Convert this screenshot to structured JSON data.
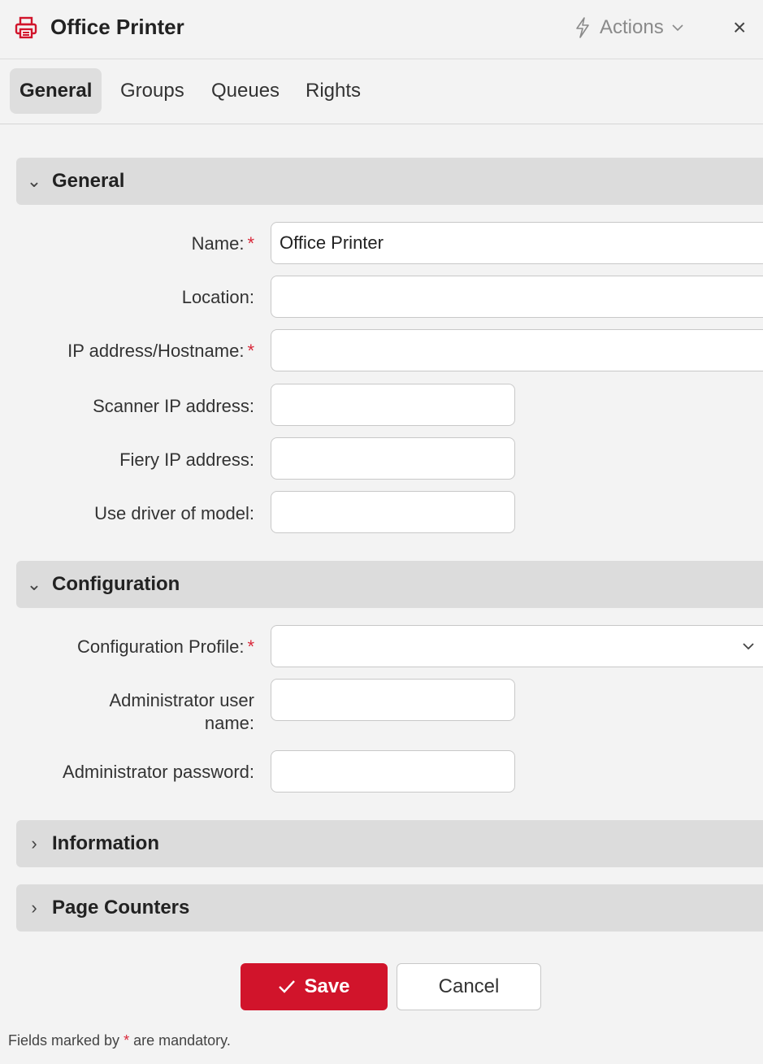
{
  "header": {
    "title": "Office Printer",
    "actions_label": "Actions",
    "close_glyph": "×",
    "icon": "printer-icon",
    "icon_color": "#d1142b"
  },
  "tabs": [
    {
      "label": "General",
      "active": true
    },
    {
      "label": "Groups",
      "active": false
    },
    {
      "label": "Queues",
      "active": false
    },
    {
      "label": "Rights",
      "active": false
    }
  ],
  "sections": {
    "general": {
      "title": "General",
      "expanded": true
    },
    "configuration": {
      "title": "Configuration",
      "expanded": true
    },
    "information": {
      "title": "Information",
      "expanded": false
    },
    "page_counters": {
      "title": "Page Counters",
      "expanded": false
    }
  },
  "general_fields": {
    "name": {
      "label": "Name:",
      "required": "*",
      "value": "Office Printer"
    },
    "location": {
      "label": "Location:",
      "value": ""
    },
    "ip": {
      "label": "IP address/Hostname:",
      "required": "*",
      "value": ""
    },
    "scanner_ip": {
      "label": "Scanner IP address:",
      "value": ""
    },
    "fiery_ip": {
      "label": "Fiery IP address:",
      "value": ""
    },
    "driver_model": {
      "label": "Use driver of model:",
      "value": ""
    }
  },
  "configuration_fields": {
    "profile": {
      "label": "Configuration Profile:",
      "required": "*",
      "value": ""
    },
    "admin_user_line1": "Administrator user",
    "admin_user_line2": "name:",
    "admin_user_value": "",
    "admin_password": {
      "label": "Administrator password:",
      "value": ""
    }
  },
  "footer": {
    "save_label": "Save",
    "cancel_label": "Cancel",
    "note_prefix": "Fields marked by",
    "note_star": "*",
    "note_suffix": "are mandatory."
  },
  "colors": {
    "accent": "#d1142b",
    "section_bg": "#dcdcdc",
    "page_bg": "#f3f3f3"
  }
}
